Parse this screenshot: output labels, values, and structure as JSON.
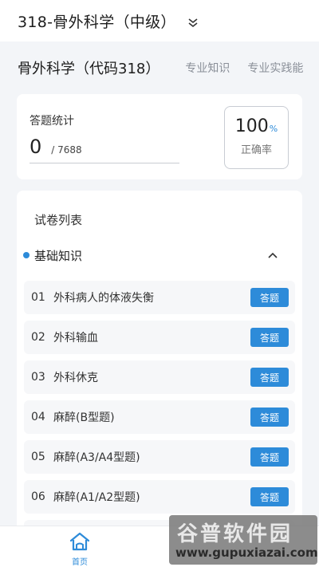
{
  "header": {
    "title": "318-骨外科学（中级）",
    "chevron_icon": "chevron-down-icon"
  },
  "subject_bar": {
    "subject": "骨外科学（代码318）",
    "tabs": [
      "专业知识",
      "专业实践能"
    ]
  },
  "stats": {
    "label": "答题统计",
    "answered": "0",
    "total": "/ 7688",
    "accuracy_value": "100",
    "accuracy_unit": "%",
    "accuracy_label": "正确率"
  },
  "paper_list": {
    "title": "试卷列表",
    "section": {
      "title": "基础知识",
      "collapse_icon": "chevron-up-icon"
    },
    "items": [
      {
        "no": "01",
        "name": "外科病人的体液失衡",
        "button": "答题"
      },
      {
        "no": "02",
        "name": "外科输血",
        "button": "答题"
      },
      {
        "no": "03",
        "name": "外科休克",
        "button": "答题"
      },
      {
        "no": "04",
        "name": "麻醉(B型题)",
        "button": "答题"
      },
      {
        "no": "05",
        "name": "麻醉(A3/A4型题)",
        "button": "答题"
      },
      {
        "no": "06",
        "name": "麻醉(A1/A2型题)",
        "button": "答题"
      }
    ]
  },
  "bottom_nav": {
    "home_label": "首页",
    "home_icon": "home-icon"
  },
  "watermark": {
    "title": "谷普软件园",
    "url": "www.gupuxiazai.com"
  },
  "colors": {
    "accent": "#2d8bd9",
    "background": "#f3f5f8"
  }
}
